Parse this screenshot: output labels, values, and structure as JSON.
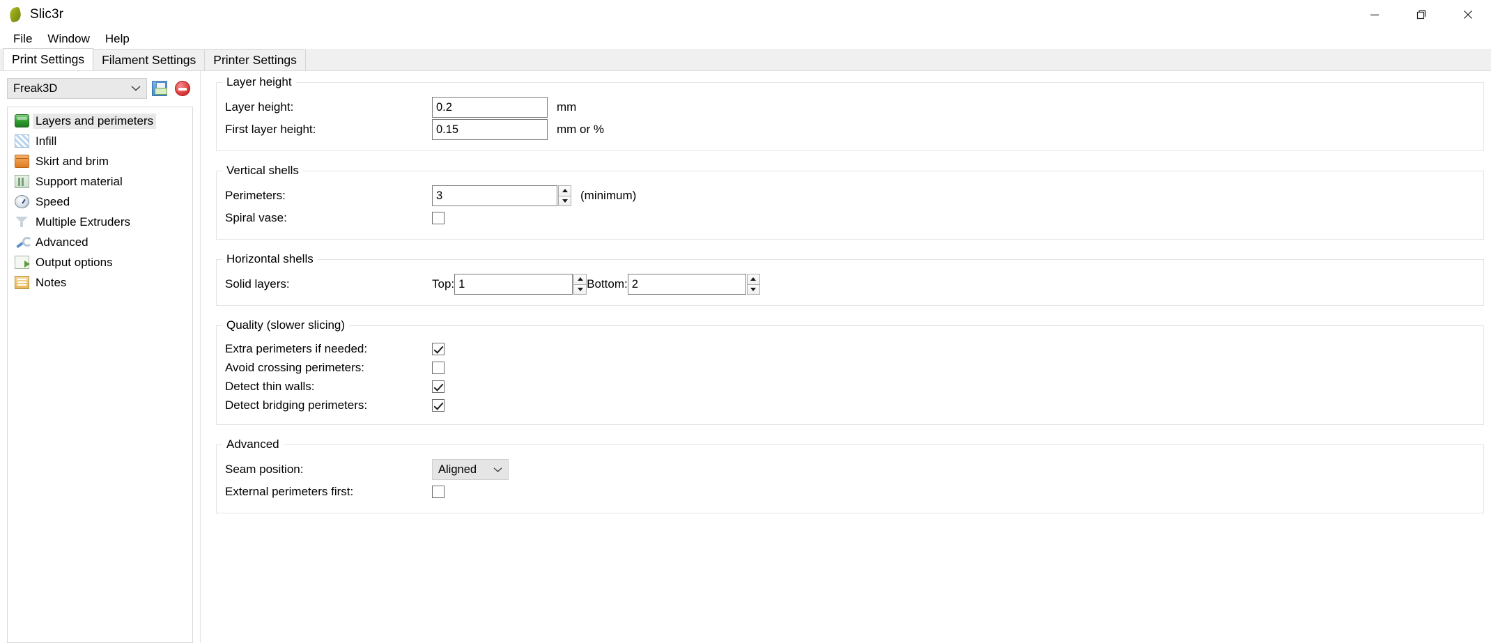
{
  "window": {
    "title": "Slic3r",
    "app_icon": "slic3r-leaf-icon",
    "controls": {
      "minimize": "minimize-icon",
      "maximize": "maximize-icon",
      "close": "close-icon"
    }
  },
  "menubar": {
    "items": [
      {
        "label": "File"
      },
      {
        "label": "Window"
      },
      {
        "label": "Help"
      }
    ]
  },
  "tabs": [
    {
      "label": "Print Settings",
      "active": true
    },
    {
      "label": "Filament Settings",
      "active": false
    },
    {
      "label": "Printer Settings",
      "active": false
    }
  ],
  "preset": {
    "value": "Freak3D",
    "save_icon": "save-floppy-icon",
    "delete_icon": "delete-preset-icon",
    "chevron": "chevron-down-icon"
  },
  "sidebar": {
    "items": [
      {
        "label": "Layers and perimeters",
        "icon": "layers-icon",
        "selected": true
      },
      {
        "label": "Infill",
        "icon": "infill-icon",
        "selected": false
      },
      {
        "label": "Skirt and brim",
        "icon": "skirt-icon",
        "selected": false
      },
      {
        "label": "Support material",
        "icon": "support-icon",
        "selected": false
      },
      {
        "label": "Speed",
        "icon": "speed-icon",
        "selected": false
      },
      {
        "label": "Multiple Extruders",
        "icon": "extruder-icon",
        "selected": false
      },
      {
        "label": "Advanced",
        "icon": "wrench-icon",
        "selected": false
      },
      {
        "label": "Output options",
        "icon": "output-icon",
        "selected": false
      },
      {
        "label": "Notes",
        "icon": "notes-icon",
        "selected": false
      }
    ]
  },
  "groups": {
    "layer_height": {
      "legend": "Layer height",
      "layer_height_label": "Layer height:",
      "layer_height_value": "0.2",
      "layer_height_unit": "mm",
      "first_layer_label": "First layer height:",
      "first_layer_value": "0.15",
      "first_layer_unit": "mm or %"
    },
    "vertical_shells": {
      "legend": "Vertical shells",
      "perimeters_label": "Perimeters:",
      "perimeters_value": "3",
      "perimeters_hint": "(minimum)",
      "spiral_vase_label": "Spiral vase:",
      "spiral_vase_checked": false
    },
    "horizontal_shells": {
      "legend": "Horizontal shells",
      "solid_layers_label": "Solid layers:",
      "top_label": "Top:",
      "top_value": "1",
      "bottom_label": "Bottom:",
      "bottom_value": "2"
    },
    "quality": {
      "legend": "Quality (slower slicing)",
      "rows": [
        {
          "label": "Extra perimeters if needed:",
          "checked": true
        },
        {
          "label": "Avoid crossing perimeters:",
          "checked": false
        },
        {
          "label": "Detect thin walls:",
          "checked": true
        },
        {
          "label": "Detect bridging perimeters:",
          "checked": true
        }
      ]
    },
    "advanced": {
      "legend": "Advanced",
      "seam_position_label": "Seam position:",
      "seam_position_value": "Aligned",
      "external_perimeters_label": "External perimeters first:",
      "external_perimeters_checked": false
    }
  },
  "colors": {
    "accent_green": "#2e9b2e",
    "tab_active_bg": "#ffffff",
    "panel_bg": "#f0f0f0",
    "border": "#e4e4e4"
  }
}
